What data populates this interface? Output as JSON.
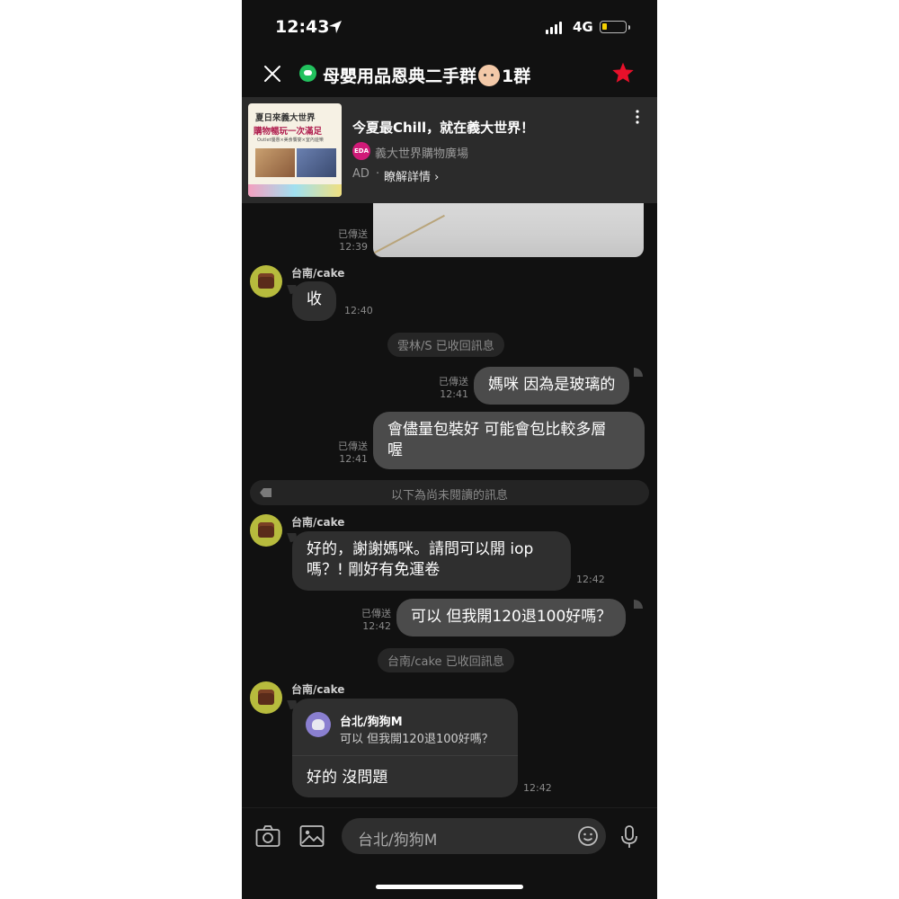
{
  "status_bar": {
    "time": "12:43",
    "network": "4G"
  },
  "header": {
    "title_prefix": "母嬰用品恩典二手群",
    "title_suffix": "1群"
  },
  "ad": {
    "image_line1": "夏日來義大世界",
    "image_line2": "購物暢玩一次滿足",
    "image_line3": "Outlet優惠×美食饗宴×室內遊樂",
    "title": "今夏最Chill，就在義大世界！",
    "logo_text": "EDA",
    "brand": "義大世界購物廣場",
    "label": "AD",
    "separator": "·",
    "link": "瞭解詳情 ›"
  },
  "messages": {
    "m0": {
      "status": "已傳送",
      "time": "12:39"
    },
    "m1": {
      "sender": "台南/cake",
      "text": "收",
      "time": "12:40"
    },
    "sys1": "雲林/S 已收回訊息",
    "m2": {
      "status": "已傳送",
      "time": "12:41",
      "text": "媽咪 因為是玻璃的"
    },
    "m3": {
      "status": "已傳送",
      "time": "12:41",
      "line1": "會儘量包裝好 可能會包比較多層",
      "line2": "喔"
    },
    "unread_divider": "以下為尚未閱讀的訊息",
    "m4": {
      "sender": "台南/cake",
      "line1": "好的，謝謝媽咪。請問可以開 iop",
      "line2": "嗎？!  剛好有免運卷",
      "time": "12:42"
    },
    "m5": {
      "status": "已傳送",
      "time": "12:42",
      "text": "可以 但我開120退100好嗎？"
    },
    "sys2": "台南/cake 已收回訊息",
    "m6": {
      "sender": "台南/cake",
      "quote_name": "台北/狗狗M",
      "quote_text": "可以 但我開120退100好嗎？",
      "text": "好的 沒問題",
      "time": "12:42"
    }
  },
  "input": {
    "value": "台北/狗狗M"
  },
  "colors": {
    "star": "#e8102a",
    "line_green": "#22c15e",
    "battery": "#f5d100"
  }
}
